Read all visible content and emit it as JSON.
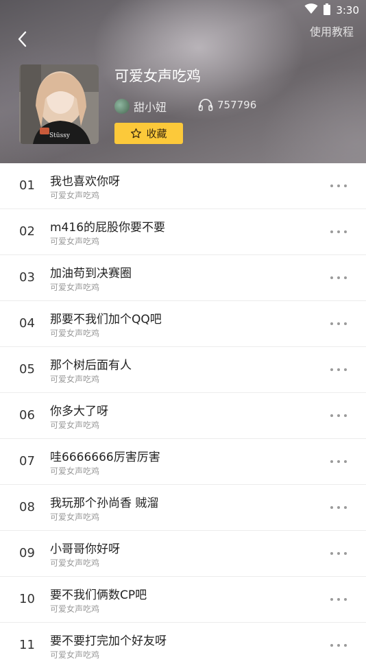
{
  "status_bar": {
    "time": "3:30"
  },
  "header": {
    "tutorial_label": "使用教程",
    "album_title": "可爱女声吃鸡",
    "author_name": "甜小妞",
    "play_count": "757796",
    "favorite_label": "收藏"
  },
  "songs": [
    {
      "index": "01",
      "title": "我也喜欢你呀",
      "subtitle": "可爱女声吃鸡"
    },
    {
      "index": "02",
      "title": "m416的屁股你要不要",
      "subtitle": "可爱女声吃鸡"
    },
    {
      "index": "03",
      "title": "加油苟到决赛圈",
      "subtitle": "可爱女声吃鸡"
    },
    {
      "index": "04",
      "title": "那要不我们加个QQ吧",
      "subtitle": "可爱女声吃鸡"
    },
    {
      "index": "05",
      "title": "那个树后面有人",
      "subtitle": "可爱女声吃鸡"
    },
    {
      "index": "06",
      "title": "你多大了呀",
      "subtitle": "可爱女声吃鸡"
    },
    {
      "index": "07",
      "title": "哇6666666厉害厉害",
      "subtitle": "可爱女声吃鸡"
    },
    {
      "index": "08",
      "title": "我玩那个孙尚香 贼溜",
      "subtitle": "可爱女声吃鸡"
    },
    {
      "index": "09",
      "title": "小哥哥你好呀",
      "subtitle": "可爱女声吃鸡"
    },
    {
      "index": "10",
      "title": "要不我们俩数CP吧",
      "subtitle": "可爱女声吃鸡"
    },
    {
      "index": "11",
      "title": "要不要打完加个好友呀",
      "subtitle": "可爱女声吃鸡"
    }
  ],
  "colors": {
    "accent": "#fcc93a",
    "more_dots": "#9a9a9a"
  }
}
